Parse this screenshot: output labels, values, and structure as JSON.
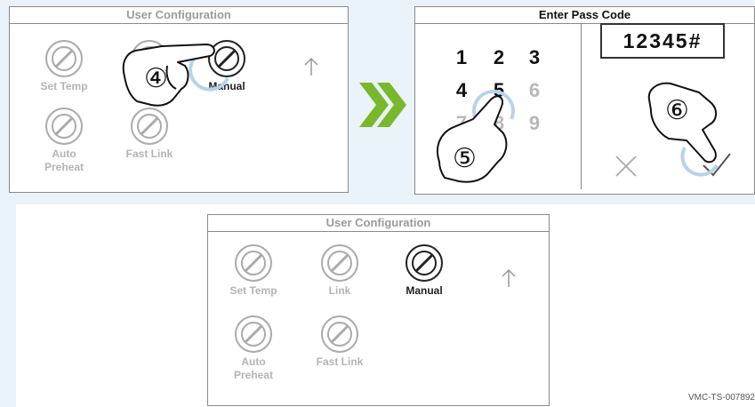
{
  "config_panel": {
    "title": "User Configuration",
    "options": [
      {
        "label": "Set Temp"
      },
      {
        "label": "Link"
      },
      {
        "label": "Manual"
      },
      {
        "label": "Auto\nPreheat"
      },
      {
        "label": "Fast Link"
      }
    ],
    "active_option": "Manual",
    "arrow_icon": "arrow-up-icon"
  },
  "pass_panel": {
    "title": "Enter Pass Code",
    "display_value": "12345#",
    "keys": [
      "1",
      "2",
      "3",
      "4",
      "5",
      "6",
      "7",
      "8",
      "9"
    ],
    "cancel_icon": "x-icon",
    "confirm_icon": "check-icon"
  },
  "steps": {
    "step4": "④",
    "step5": "⑤",
    "step6": "⑥"
  },
  "arrow_between": "double-chevron-right-icon",
  "colors": {
    "arrow_green": "#78b82a",
    "tap_ring": "#b7d3ec",
    "border": "#8a8a8a"
  },
  "footer_code": "VMC-TS-007892"
}
